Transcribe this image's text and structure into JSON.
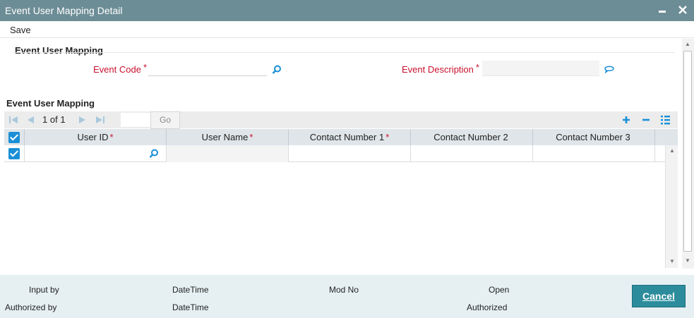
{
  "window": {
    "title": "Event User Mapping Detail"
  },
  "menu": {
    "save": "Save"
  },
  "section1": {
    "title": "Event User Mapping",
    "event_code": {
      "label": "Event Code",
      "required": "*",
      "value": ""
    },
    "event_description": {
      "label": "Event Description",
      "required": "*",
      "value": ""
    }
  },
  "section2": {
    "title": "Event User Mapping",
    "pager": {
      "current": "1",
      "of_label": "of",
      "total": "1",
      "go": "Go"
    },
    "columns": [
      {
        "label": "User ID",
        "required": "*"
      },
      {
        "label": "User Name",
        "required": "*"
      },
      {
        "label": "Contact Number 1",
        "required": "*"
      },
      {
        "label": "Contact Number 2",
        "required": ""
      },
      {
        "label": "Contact Number 3",
        "required": ""
      }
    ]
  },
  "footer": {
    "input_by": "Input by",
    "authorized_by": "Authorized by",
    "datetime_1": "DateTime",
    "datetime_2": "DateTime",
    "mod_no": "Mod No",
    "open": "Open",
    "authorized": "Authorized",
    "cancel": "Cancel"
  },
  "colors": {
    "titlebar": "#6d8d96",
    "accent": "#1a8fd6",
    "required": "#c8102e",
    "cancel_button": "#2c8c9c"
  }
}
